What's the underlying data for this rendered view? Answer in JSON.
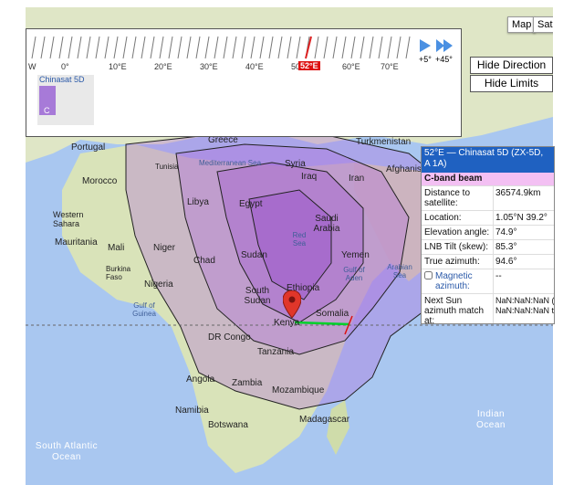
{
  "map": {
    "map_type_labels": [
      "Map",
      "Sat"
    ],
    "countries": [
      "Greece",
      "Turkmenistan",
      "Portugal",
      "Tunisia",
      "Mediterranean Sea",
      "Syria",
      "Iraq",
      "Iran",
      "Afghanist",
      "Morocco",
      "Libya",
      "Egypt",
      "Western Sahara",
      "Saudi Arabia",
      "Mauritania",
      "Mali",
      "Niger",
      "Chad",
      "Sudan",
      "Yemen",
      "Burkina Faso",
      "Nigeria",
      "Gulf of Guinea",
      "Ethiopia",
      "Somalia",
      "South Sudan",
      "Kenya",
      "DR Congo",
      "Tanzania",
      "Angola",
      "Zambia",
      "Mozambique",
      "Namibia",
      "Botswana",
      "Madagascar",
      "Indian Ocean",
      "South Atlantic Ocean",
      "Arabian Sea",
      "Gulf of Aden",
      "Red Sea"
    ],
    "pin": "location-pin"
  },
  "scale": {
    "degree_labels": [
      "W",
      "0°",
      "10°E",
      "20°E",
      "30°E",
      "40°E",
      "50°E",
      "60°E",
      "70°E"
    ],
    "selected_degree": "52°E",
    "step_small": "+5°",
    "step_large": "+45°"
  },
  "buttons": {
    "hide_directions": "Hide Direction",
    "hide_limits": "Hide Limits"
  },
  "satellite_thumb": {
    "name": "Chinasat 5D",
    "band": "C"
  },
  "info": {
    "title": "52°E — Chinasat 5D (ZX-5D, A 1A)",
    "beam": "C-band beam",
    "rows": [
      {
        "k": "Distance to satellite:",
        "v": "36574.9km"
      },
      {
        "k": "Location:",
        "v": "1.05°N 39.2°"
      },
      {
        "k": "Elevation angle:",
        "v": "74.9°"
      },
      {
        "k": "LNB Tilt (skew):",
        "v": "85.3°"
      },
      {
        "k": "True azimuth:",
        "v": "94.6°"
      },
      {
        "k": "Magnetic azimuth:",
        "v": "--"
      },
      {
        "k": "Next Sun azimuth match at:",
        "v": "NaN:NaN:NaN (GMT)\nNaN:NaN:NaN time)"
      }
    ]
  },
  "colors": {
    "ocean": "#a9c7f0",
    "land": "#dfe6c6",
    "beam": "#b069dd",
    "panel_title": "#1f61c1",
    "panel_sub": "#f3c0f3"
  }
}
